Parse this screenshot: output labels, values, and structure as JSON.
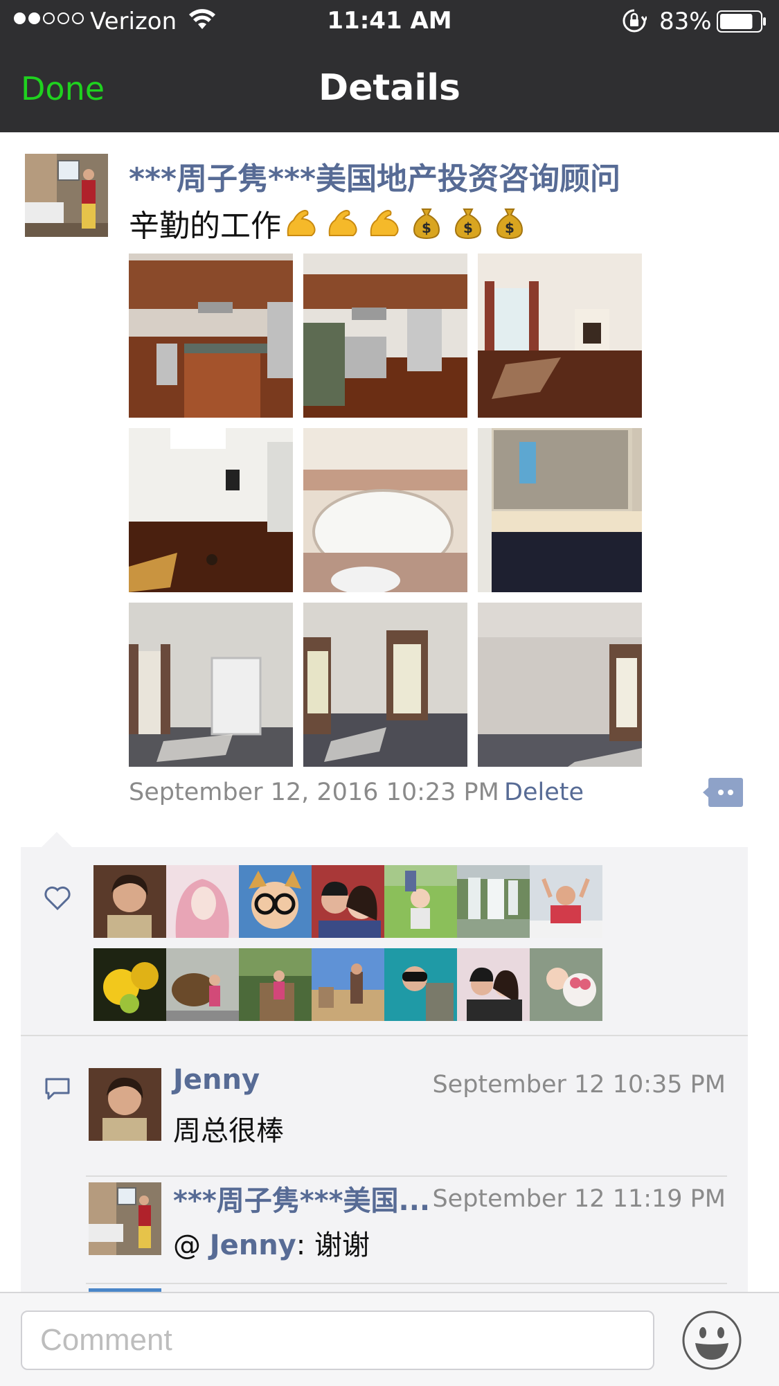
{
  "status_bar": {
    "signal_dots": [
      true,
      true,
      false,
      false,
      false
    ],
    "carrier": "Verizon",
    "time": "11:41 AM",
    "battery_percent": "83%",
    "battery_level": 0.83
  },
  "nav": {
    "done_label": "Done",
    "title": "Details"
  },
  "post": {
    "author": "***周子隽***美国地产投资咨询顾问",
    "text": "辛勤的工作",
    "emoji_icons": [
      "flexed-biceps-icon",
      "flexed-biceps-icon",
      "flexed-biceps-icon",
      "money-bag-icon",
      "money-bag-icon",
      "money-bag-icon"
    ],
    "photos": [
      "kitchen-1",
      "kitchen-2",
      "living-room-fireplace",
      "dining-room",
      "bathtub",
      "bathroom-vanity",
      "bedroom-closet",
      "bedroom-windows",
      "bedroom-empty"
    ],
    "timestamp": "September 12, 2016 10:23 PM",
    "delete_label": "Delete"
  },
  "likes": {
    "avatar_count": 14
  },
  "comments": [
    {
      "author": "Jenny",
      "time": "September 12 10:35 PM",
      "text": "周总很棒"
    },
    {
      "author": "***周子隽***美国...",
      "time": "September 12 11:19 PM",
      "reply_prefix": "@ ",
      "reply_to": "Jenny",
      "text": ": 谢谢"
    }
  ],
  "comment_bar": {
    "placeholder": "Comment"
  },
  "colors": {
    "nav_bg": "#2f2f31",
    "done_green": "#1fd21f",
    "link_blue": "#576b95",
    "muted_gray": "#8a8a8a",
    "panel_bg": "#f3f3f5"
  }
}
